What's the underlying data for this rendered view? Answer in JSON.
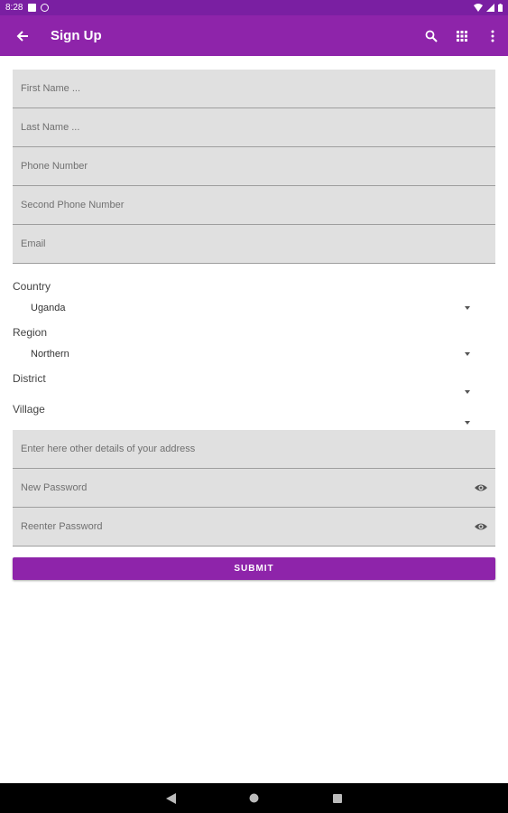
{
  "status_bar": {
    "time": "8:28"
  },
  "app_bar": {
    "title": "Sign Up",
    "icons": [
      "back-arrow-icon",
      "search-icon",
      "grid-icon",
      "more-vert-icon"
    ]
  },
  "form": {
    "first_name": {
      "placeholder": "First Name ..."
    },
    "last_name": {
      "placeholder": "Last Name ..."
    },
    "phone": {
      "placeholder": "Phone Number"
    },
    "second_phone": {
      "placeholder": "Second Phone Number"
    },
    "email": {
      "placeholder": "Email"
    },
    "country": {
      "label": "Country",
      "value": "Uganda"
    },
    "region": {
      "label": "Region",
      "value": "Northern"
    },
    "district": {
      "label": "District",
      "value": ""
    },
    "village": {
      "label": "Village",
      "value": ""
    },
    "address_details": {
      "placeholder": "Enter here other details of your address"
    },
    "new_password": {
      "placeholder": "New Password"
    },
    "reenter_password": {
      "placeholder": "Reenter Password"
    },
    "submit_label": "SUBMIT"
  },
  "colors": {
    "primary": "#8e24aa",
    "status_bar": "#7a1fa2",
    "field_bg": "#e0e0e0"
  }
}
